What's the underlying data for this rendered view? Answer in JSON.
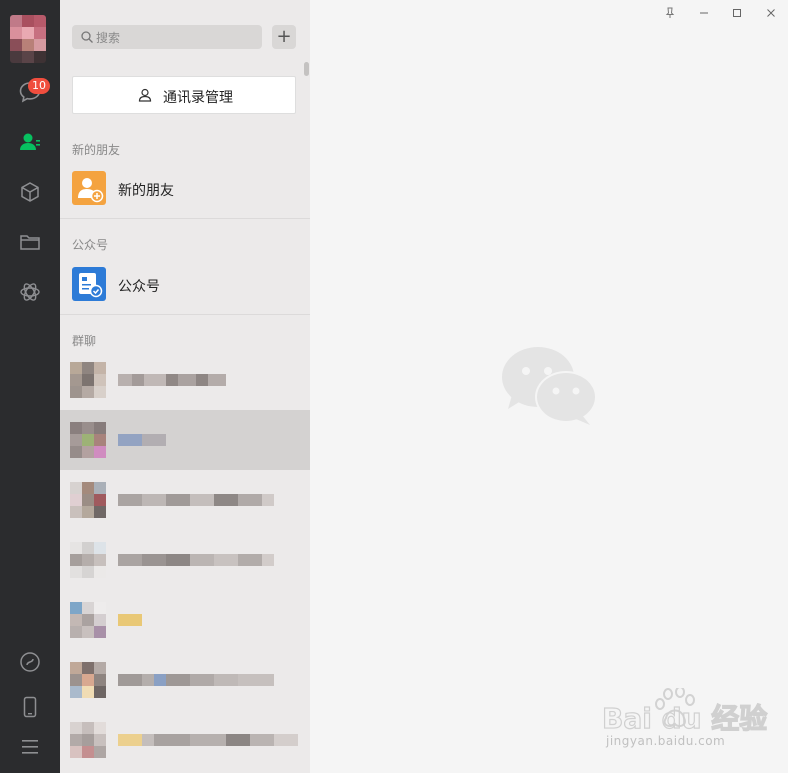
{
  "sidebar": {
    "chat_badge": "10",
    "icons": [
      "chat-icon",
      "contacts-icon",
      "cube-icon",
      "folder-icon",
      "mini-program-icon",
      "channels-icon",
      "phone-icon",
      "menu-icon"
    ],
    "colors": {
      "background": "#2b2c2e",
      "active": "#07c160",
      "badge": "#f04e3e"
    }
  },
  "search": {
    "placeholder": "搜索"
  },
  "contacts": {
    "manage_label": "通讯录管理",
    "new_friends_section": "新的朋友",
    "new_friends_item": "新的朋友",
    "official_section": "公众号",
    "official_item": "公众号",
    "groups_section": "群聊"
  },
  "watermark": {
    "brand": "Bai du 经验",
    "url": "jingyan.baidu.com"
  }
}
